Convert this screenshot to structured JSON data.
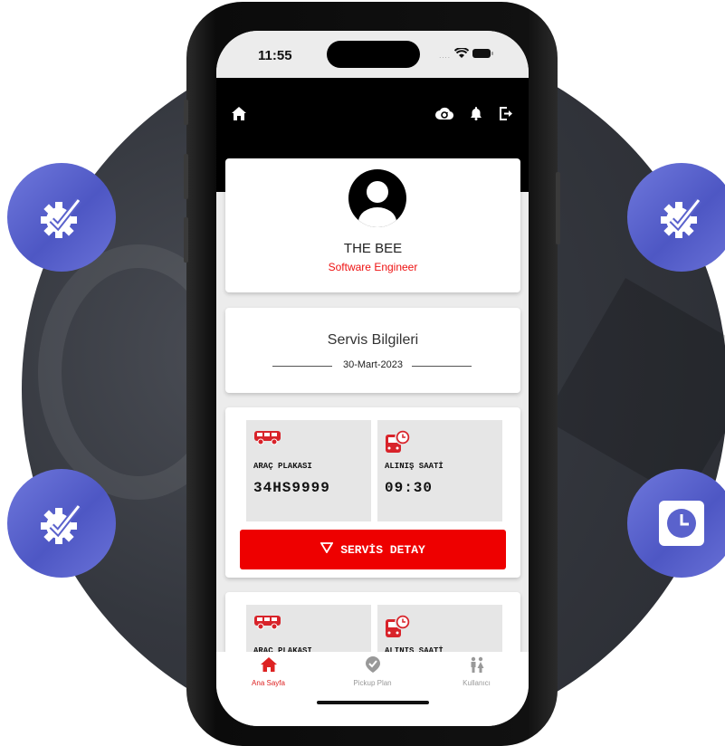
{
  "status": {
    "time": "11:55"
  },
  "profile": {
    "name": "THE BEE",
    "role": "Software Engineer"
  },
  "service": {
    "title": "Servis Bilgileri",
    "date": "30-Mart-2023"
  },
  "trips": [
    {
      "plate_label": "ARAÇ PLAKASI",
      "plate": "34HS9999",
      "time_label": "ALINIŞ SAATİ",
      "time": "09:30",
      "detail_label": "SERVİS DETAY"
    },
    {
      "plate_label": "ARAÇ PLAKASI",
      "time_label": "ALINIŞ SAATİ"
    }
  ],
  "tabs": [
    {
      "label": "Ana Sayfa",
      "icon": "home-icon",
      "active": true
    },
    {
      "label": "Pickup Plan",
      "icon": "check-badge-icon",
      "active": false
    },
    {
      "label": "Kullanıcı",
      "icon": "people-icon",
      "active": false
    }
  ],
  "colors": {
    "accent": "#e00000",
    "badge": "#5a62cc",
    "appbar": "#000000"
  },
  "decor_icons": [
    "gear-check-icon",
    "gear-check-icon",
    "gear-check-icon",
    "clock-icon"
  ]
}
